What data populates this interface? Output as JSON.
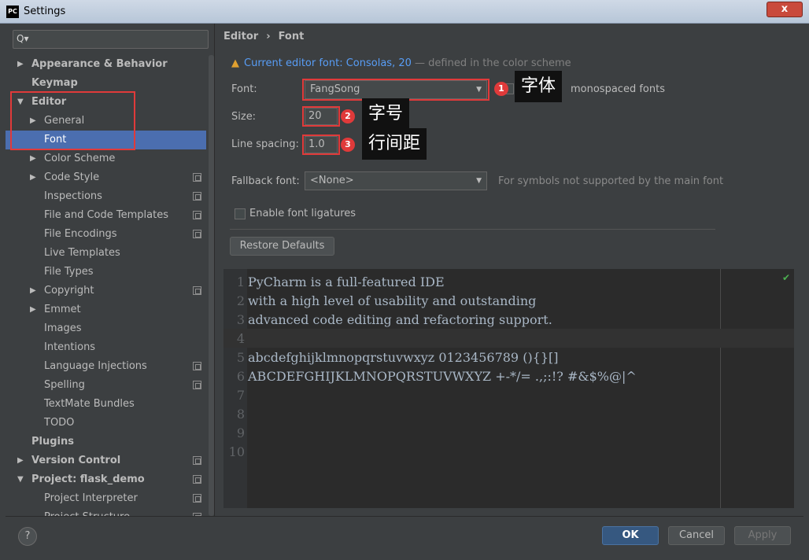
{
  "window": {
    "title": "Settings",
    "logo": "PC",
    "close": "x"
  },
  "search": {
    "icon": "Q▾",
    "value": ""
  },
  "tree": {
    "items": [
      {
        "label": "Appearance & Behavior",
        "arrow": "▶"
      },
      {
        "label": "Keymap",
        "arrow": ""
      },
      {
        "label": "Editor",
        "arrow": "▼"
      },
      {
        "label": "General",
        "arrow": "▶"
      },
      {
        "label": "Font",
        "arrow": ""
      },
      {
        "label": "Color Scheme",
        "arrow": "▶"
      },
      {
        "label": "Code Style",
        "arrow": "▶"
      },
      {
        "label": "Inspections",
        "arrow": ""
      },
      {
        "label": "File and Code Templates",
        "arrow": ""
      },
      {
        "label": "File Encodings",
        "arrow": ""
      },
      {
        "label": "Live Templates",
        "arrow": ""
      },
      {
        "label": "File Types",
        "arrow": ""
      },
      {
        "label": "Copyright",
        "arrow": "▶"
      },
      {
        "label": "Emmet",
        "arrow": "▶"
      },
      {
        "label": "Images",
        "arrow": ""
      },
      {
        "label": "Intentions",
        "arrow": ""
      },
      {
        "label": "Language Injections",
        "arrow": ""
      },
      {
        "label": "Spelling",
        "arrow": ""
      },
      {
        "label": "TextMate Bundles",
        "arrow": ""
      },
      {
        "label": "TODO",
        "arrow": ""
      },
      {
        "label": "Plugins",
        "arrow": ""
      },
      {
        "label": "Version Control",
        "arrow": "▶"
      },
      {
        "label": "Project: flask_demo",
        "arrow": "▼"
      },
      {
        "label": "Project Interpreter",
        "arrow": ""
      },
      {
        "label": "Project Structure",
        "arrow": ""
      }
    ]
  },
  "breadcrumb": {
    "part1": "Editor",
    "sep": "›",
    "part2": "Font"
  },
  "notice": {
    "icon": "▲",
    "link": "Current editor font: Consolas, 20",
    "rest": "— defined in the color scheme"
  },
  "font": {
    "label": "Font:",
    "value": "FangSong",
    "dropdown": "▼",
    "monospaced_label": "monospaced fonts"
  },
  "size": {
    "label": "Size:",
    "value": "20"
  },
  "line_spacing": {
    "label": "Line spacing:",
    "value": "1.0"
  },
  "fallback": {
    "label": "Fallback font:",
    "value": "<None>",
    "dropdown": "▼",
    "hint": "For symbols not supported by the main font"
  },
  "ligatures": {
    "label": "Enable font ligatures"
  },
  "restore_button": "Restore Defaults",
  "annotations": [
    {
      "num": "1",
      "text": "字体"
    },
    {
      "num": "2",
      "text": "字号"
    },
    {
      "num": "3",
      "text": "行间距"
    }
  ],
  "preview": {
    "check": "✔",
    "lines": [
      {
        "num": "1",
        "text": "PyCharm is a full-featured IDE"
      },
      {
        "num": "2",
        "text": "with a high level of usability and outstanding"
      },
      {
        "num": "3",
        "text": "advanced code editing and refactoring support."
      },
      {
        "num": "4",
        "text": ""
      },
      {
        "num": "5",
        "text": "abcdefghijklmnopqrstuvwxyz 0123456789 (){}[]"
      },
      {
        "num": "6",
        "text": "ABCDEFGHIJKLMNOPQRSTUVWXYZ +-*/= .,;:!? #&$%@|^"
      },
      {
        "num": "7",
        "text": ""
      },
      {
        "num": "8",
        "text": ""
      },
      {
        "num": "9",
        "text": ""
      },
      {
        "num": "10",
        "text": ""
      }
    ]
  },
  "footer": {
    "help": "?",
    "ok": "OK",
    "cancel": "Cancel",
    "apply": "Apply"
  }
}
